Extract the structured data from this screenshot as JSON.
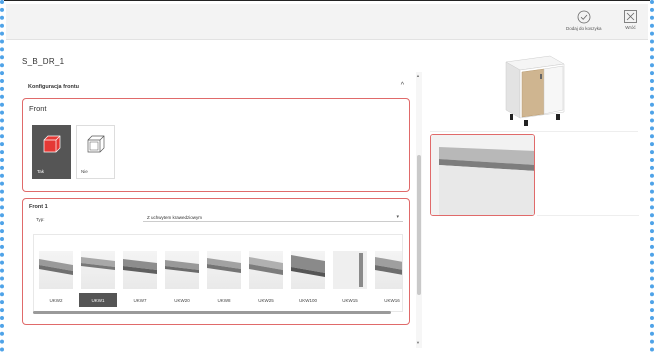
{
  "header": {
    "add_to_cart_label": "Dodaj do koszyka",
    "close_label": "Wróć"
  },
  "product": {
    "title": "S_B_DR_1"
  },
  "config_panel": {
    "title": "Konfiguracja frontu",
    "front_section": {
      "heading": "Front",
      "options": [
        {
          "label": "Tak",
          "selected": true
        },
        {
          "label": "Nie",
          "selected": false
        }
      ]
    },
    "front1_section": {
      "heading": "Front 1",
      "type_label": "Typ:",
      "type_value": "Z uchwytem krawedziowym",
      "handles": [
        {
          "label": "UKW2",
          "selected": false
        },
        {
          "label": "UKW1",
          "selected": true
        },
        {
          "label": "UKW7",
          "selected": false
        },
        {
          "label": "UKW20",
          "selected": false
        },
        {
          "label": "UKW8",
          "selected": false
        },
        {
          "label": "UKW25",
          "selected": false
        },
        {
          "label": "UKW100",
          "selected": false
        },
        {
          "label": "UKW15",
          "selected": false
        },
        {
          "label": "UKW16",
          "selected": false
        }
      ]
    }
  },
  "colors": {
    "accent_red": "#e06a6a",
    "selected_bg": "#555555",
    "front_color": "#e53935"
  }
}
